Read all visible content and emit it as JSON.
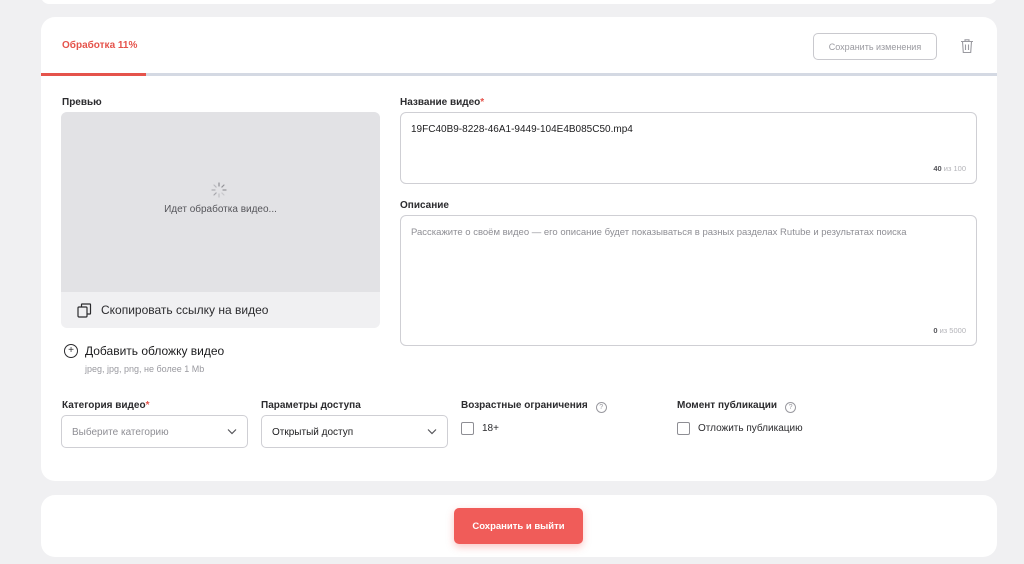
{
  "header": {
    "status": "Обработка 11%",
    "progress": 0.11,
    "save_changes": "Сохранить изменения",
    "delete_icon": "trash-icon"
  },
  "preview": {
    "label": "Превью",
    "processing": "Идет обработка видео...",
    "copy_link": "Скопировать ссылку на видео",
    "add_cover": "Добавить обложку видео",
    "cover_hint": "jpeg, jpg, png, не более 1 Mb"
  },
  "title_field": {
    "label": "Название видео",
    "required_mark": "*",
    "value": "19FC40B9-8228-46A1-9449-104E4B085C50.mp4",
    "count": "40",
    "count_suffix": "из 100"
  },
  "description": {
    "label": "Описание",
    "placeholder": "Расскажите о своём видео — его описание будет показываться в разных разделах Rutube и результатах поиска",
    "count": "0",
    "count_suffix": "из 5000"
  },
  "category": {
    "label": "Категория видео",
    "required_mark": "*",
    "placeholder": "Выберите категорию"
  },
  "access": {
    "label": "Параметры доступа",
    "value": "Открытый доступ"
  },
  "age": {
    "label": "Возрастные ограничения",
    "help": "?",
    "option": "18+",
    "checked": false
  },
  "publish": {
    "label": "Момент публикации",
    "help": "?",
    "option": "Отложить публикацию",
    "checked": false
  },
  "footer": {
    "save_exit": "Сохранить и выйти"
  },
  "colors": {
    "accent": "#e5534b",
    "button": "#f05c59",
    "progress_track": "#d4d9e3",
    "background": "#f0f0f2"
  }
}
